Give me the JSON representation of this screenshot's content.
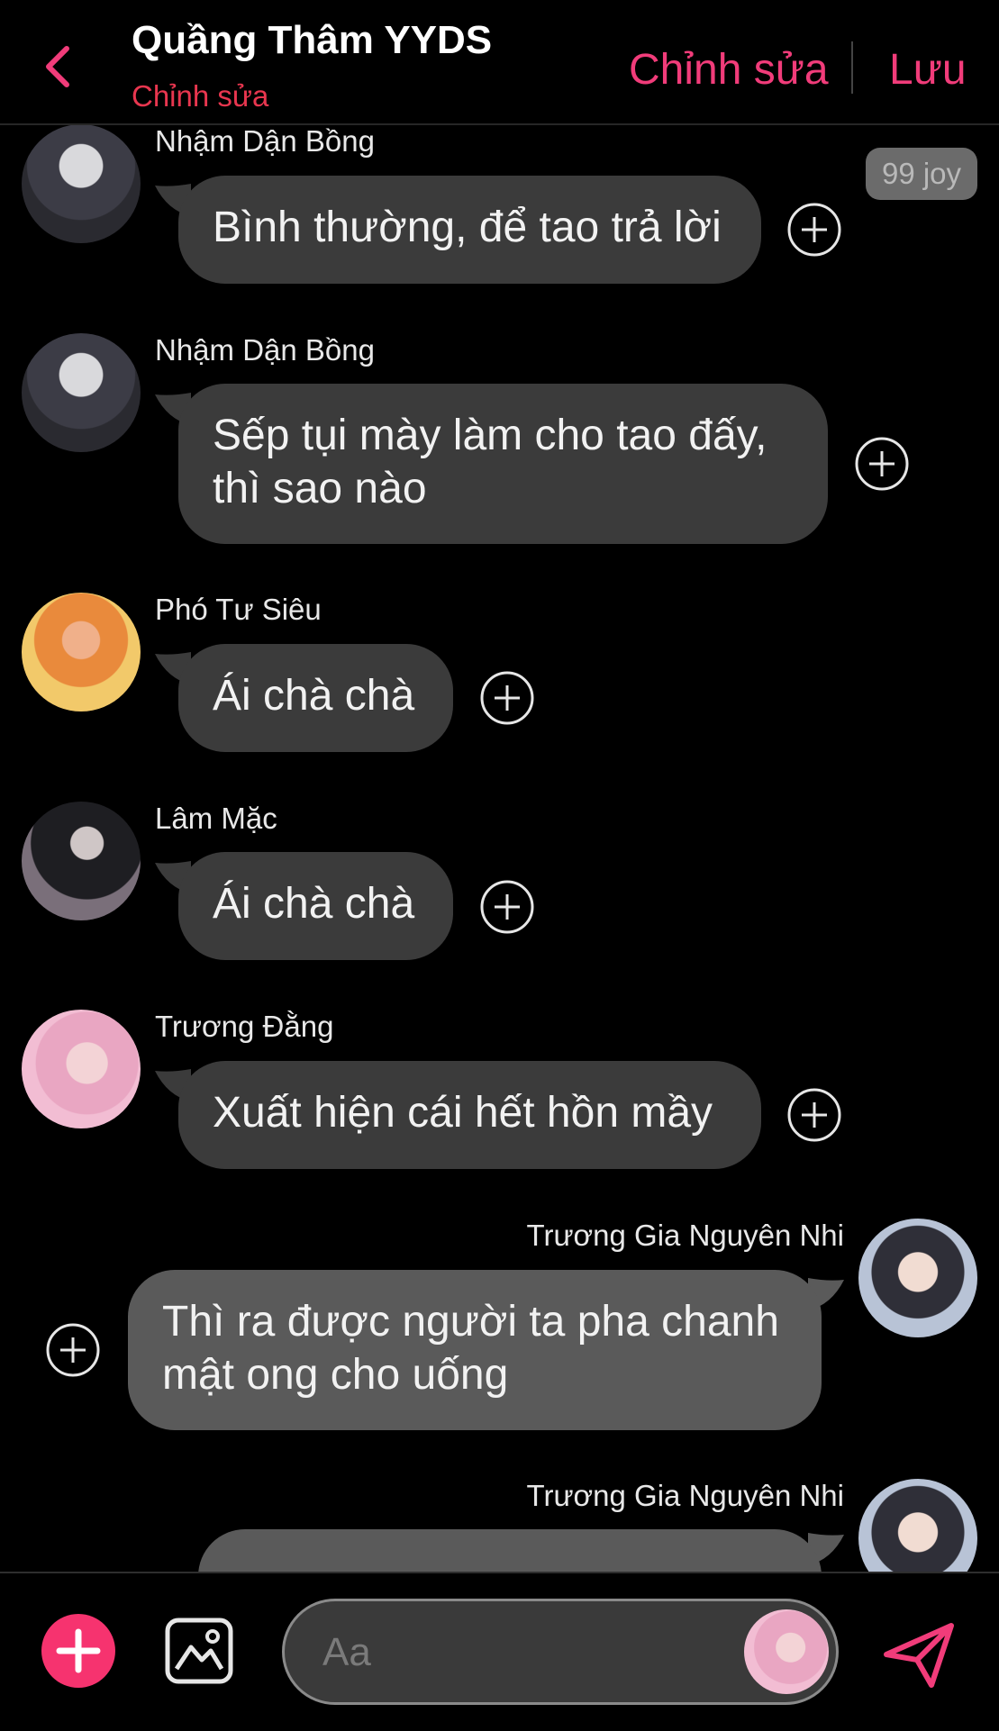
{
  "header": {
    "title": "Quầng Thâm YYDS",
    "subtitle": "Chỉnh sửa",
    "edit_label": "Chỉnh sửa",
    "save_label": "Lưu"
  },
  "badge": "99 joy",
  "messages": [
    {
      "sender": "Nhậm Dận Bồng",
      "lines": [
        "Bình thường, để tao trả lời"
      ]
    },
    {
      "sender": "Nhậm Dận Bồng",
      "lines": [
        "Sếp tụi mày làm cho tao đấy,",
        "thì sao nào"
      ]
    },
    {
      "sender": "Phó Tư Siêu",
      "lines": [
        "Ái chà chà"
      ]
    },
    {
      "sender": "Lâm Mặc",
      "lines": [
        "Ái chà chà"
      ]
    },
    {
      "sender": "Trương Đằng",
      "lines": [
        "Xuất hiện cái hết hồn mầy"
      ]
    },
    {
      "sender": "Trương Gia Nguyên Nhi",
      "lines": [
        "Thì ra được người ta pha chanh",
        "mật ong cho uống"
      ]
    },
    {
      "sender": "Trương Gia Nguyên Nhi",
      "lines": [
        ""
      ]
    }
  ],
  "composer": {
    "placeholder": "Aa"
  },
  "colors": {
    "accent": "#f13c7a",
    "subtitle": "#e8364f",
    "bubble_other": "#3b3b3b",
    "bubble_mine": "#5a5a5a"
  },
  "icons": [
    "chevron-left-icon",
    "plus-circle-icon",
    "plus-icon",
    "image-icon",
    "send-icon"
  ]
}
